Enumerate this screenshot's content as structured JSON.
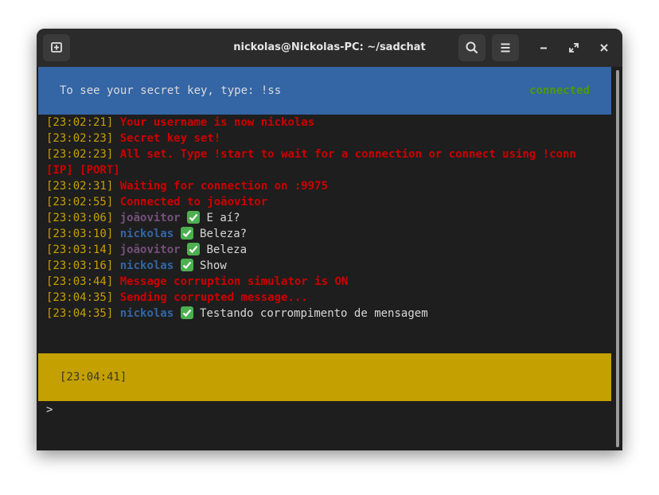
{
  "window": {
    "title": "nickolas@Nickolas-PC: ~/sadchat"
  },
  "titlebar": {
    "new_tab_icon": "new-tab-icon",
    "search_icon": "search-icon",
    "menu_icon": "hamburger-menu-icon",
    "minimize_icon": "minimize-icon",
    "maximize_icon": "maximize-icon",
    "close_icon": "close-icon"
  },
  "banner": {
    "text": "To see your secret key, type: !ss",
    "status": "connected",
    "background": "#3465a4",
    "status_color": "#4e9a06"
  },
  "log": [
    {
      "time": "[23:02:21]",
      "kind": "system",
      "text": "Your username is now nickolas"
    },
    {
      "time": "[23:02:23]",
      "kind": "system",
      "text": "Secret key set!"
    },
    {
      "time": "[23:02:23]",
      "kind": "system",
      "text": "All set. Type !start to wait for a connection or connect using !conn"
    },
    {
      "time": "",
      "kind": "system",
      "text": "[IP] [PORT]"
    },
    {
      "time": "[23:02:31]",
      "kind": "system",
      "text": "Waiting for connection on :9975"
    },
    {
      "time": "[23:02:55]",
      "kind": "system",
      "text": "Connected to joãovitor"
    },
    {
      "time": "[23:03:06]",
      "kind": "message",
      "user": "joãovitor",
      "user_color": "#75507b",
      "text": "E aí?"
    },
    {
      "time": "[23:03:10]",
      "kind": "message",
      "user": "nickolas",
      "user_color": "#3465a4",
      "text": "Beleza?"
    },
    {
      "time": "[23:03:14]",
      "kind": "message",
      "user": "joãovitor",
      "user_color": "#75507b",
      "text": "Beleza"
    },
    {
      "time": "[23:03:16]",
      "kind": "message",
      "user": "nickolas",
      "user_color": "#3465a4",
      "text": "Show"
    },
    {
      "time": "[23:03:44]",
      "kind": "system",
      "text": "Message corruption simulator is ON"
    },
    {
      "time": "[23:04:35]",
      "kind": "system",
      "text": "Sending corrupted message..."
    },
    {
      "time": "[23:04:35]",
      "kind": "message",
      "user": "nickolas",
      "user_color": "#3465a4",
      "text": "Testando corrompimento de mensagem"
    }
  ],
  "statusbar": {
    "time": "[23:04:41]",
    "background": "#c4a000"
  },
  "prompt": {
    "symbol": ">"
  },
  "colors": {
    "timestamp": "#c4a000",
    "system": "#cc0000",
    "text": "#d8d8d8",
    "check": "#4caf50"
  }
}
